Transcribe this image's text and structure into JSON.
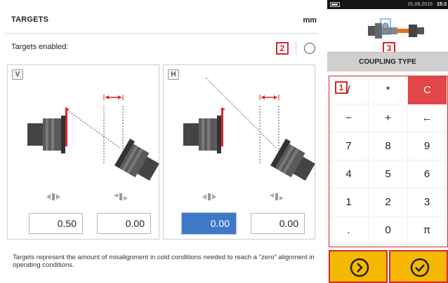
{
  "header": {
    "title": "TARGETS",
    "unit": "mm"
  },
  "targets_enabled": {
    "label": "Targets enabled:",
    "marker": "2",
    "checked": false
  },
  "panels": [
    {
      "badge": "V",
      "values": [
        "0.50",
        "0.00"
      ],
      "active_index": -1
    },
    {
      "badge": "H",
      "values": [
        "0.00",
        "0.00"
      ],
      "active_index": 0
    }
  ],
  "note": "Targets represent the amount of misalignment in cold conditions needed to reach a \"zero\" alignment in operating conditions.",
  "status": {
    "date": "01.06.2015",
    "time": "15:3"
  },
  "machine_marker": "3",
  "coupling_type": "COUPLING TYPE",
  "keypad": {
    "marker": "1",
    "keys": [
      [
        "/",
        "*",
        "C"
      ],
      [
        "−",
        "+",
        "←"
      ],
      [
        "7",
        "8",
        "9"
      ],
      [
        "4",
        "5",
        "6"
      ],
      [
        "1",
        "2",
        "3"
      ],
      [
        ".",
        "0",
        "π"
      ]
    ]
  },
  "buttons": {
    "next_icon": "chevron-right-circle-icon",
    "ok_icon": "check-circle-icon"
  },
  "colors": {
    "accent_red": "#d8262b",
    "button_yellow": "#f5b800",
    "active_blue": "#3f78c4",
    "clear_red": "#e2454a"
  }
}
